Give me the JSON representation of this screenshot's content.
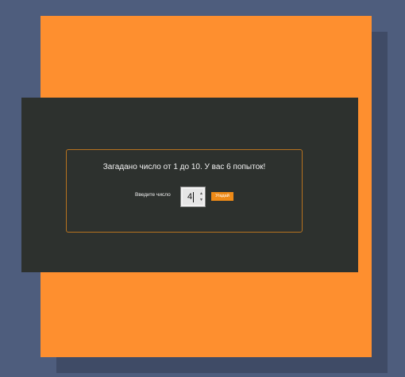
{
  "colors": {
    "background": "#4e5d7d",
    "orange_panel": "#fe8f2f",
    "dark_panel": "#2d312e",
    "accent_border": "#b8731f",
    "button": "#ee8a17"
  },
  "game": {
    "title": "Загадано число от 1 до 10. У вас 6 попыток!",
    "input_label": "Введите число",
    "input_value": "4",
    "guess_button_label": "Угадай"
  },
  "icons": {
    "spinner_up": "▲",
    "spinner_down": "▼"
  }
}
